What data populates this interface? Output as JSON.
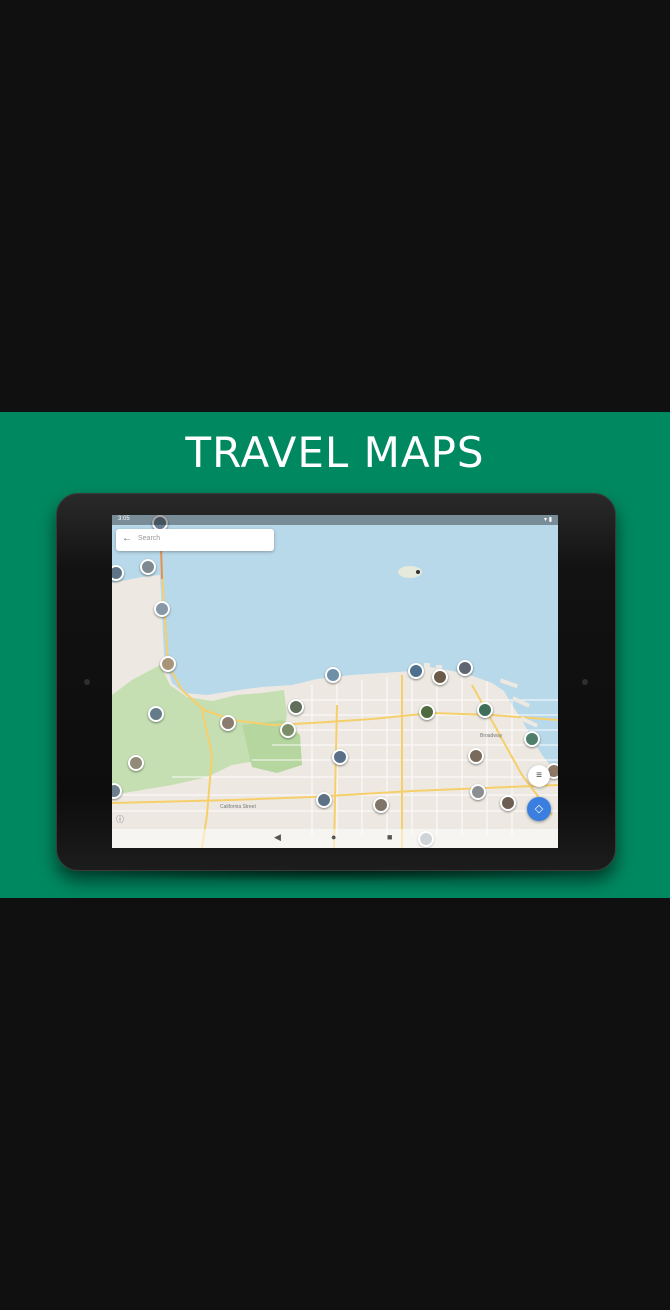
{
  "banner": {
    "title": "TRAVEL MAPS",
    "background": "#008960"
  },
  "device": {
    "status_time": "3:05",
    "status_icons": "▾ ▮"
  },
  "search": {
    "placeholder": "Search",
    "back_icon": "arrow-left-icon"
  },
  "map": {
    "water_color": "#b8d9ea",
    "land_color": "#ede9e2",
    "park_color": "#c5dfb3",
    "road_color": "#f6cf6a",
    "labels": [
      "California Street",
      "Broadway"
    ],
    "photo_pins": 30,
    "info_icon": "ⓘ"
  },
  "buttons": {
    "filter_icon": "≡",
    "locate_icon": "◇"
  },
  "navbar": {
    "back": "◀",
    "home": "●",
    "recents": "■"
  }
}
